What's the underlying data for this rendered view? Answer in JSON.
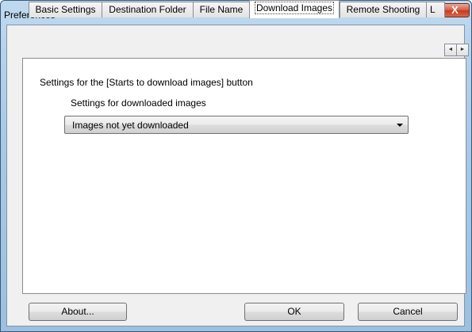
{
  "window": {
    "title": "Preferences",
    "close_glyph": "X"
  },
  "tabs": [
    {
      "label": "Basic Settings"
    },
    {
      "label": "Destination Folder"
    },
    {
      "label": "File Name"
    },
    {
      "label": "Download Images",
      "active": true
    },
    {
      "label": "Remote Shooting"
    },
    {
      "label": "L"
    }
  ],
  "tab_scroll": {
    "left_glyph": "◄",
    "right_glyph": "►"
  },
  "panel": {
    "heading": "Settings for the [Starts to download images] button",
    "sub_label": "Settings for downloaded images",
    "dropdown": {
      "selected": "Images not yet downloaded"
    }
  },
  "buttons": {
    "about": "About...",
    "ok": "OK",
    "cancel": "Cancel"
  }
}
